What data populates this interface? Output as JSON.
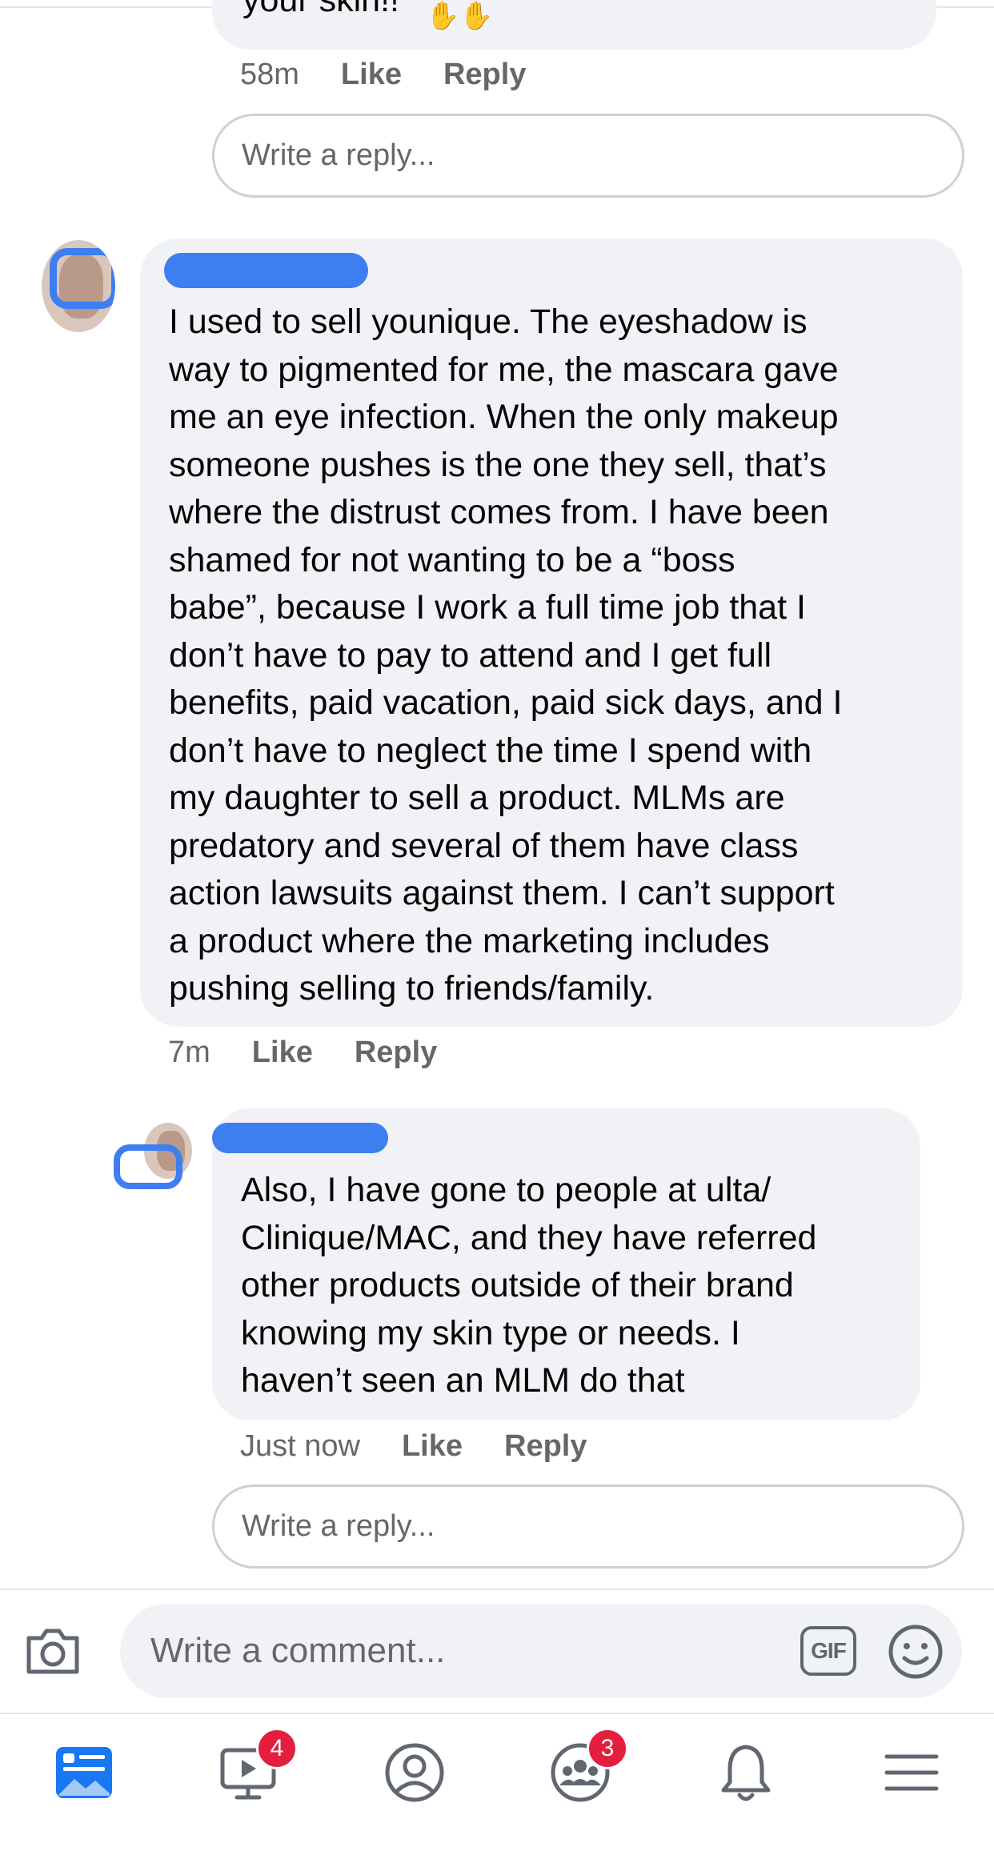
{
  "thread": {
    "prev_reply": {
      "text_fragment": "your skin!!",
      "time": "58m",
      "like": "Like",
      "reply": "Reply"
    },
    "reply_box_1": {
      "placeholder": "Write a reply..."
    },
    "comment": {
      "author": "",
      "text": "I used to sell younique. The eyeshadow is\nway to pigmented for me, the mascara gave\nme an eye infection. When the only makeup\nsomeone pushes is the one they sell, that’s\nwhere the distrust comes from. I have been\nshamed for not wanting to be a “boss\nbabe”, because I work a full time job that I\ndon’t have to pay to attend and I get full\nbenefits, paid vacation, paid sick days, and I\ndon’t have to neglect the time I spend with\nmy daughter to sell a product. MLMs are\npredatory and several of them have class\naction lawsuits against them. I can’t support\na product where the marketing includes\npushing selling to friends/family.",
      "time": "7m",
      "like": "Like",
      "reply": "Reply"
    },
    "reply": {
      "author": "",
      "text": "Also, I have gone to people at ulta/\nClinique/MAC, and they have referred\nother products outside of their brand\nknowing my skin type or needs. I\nhaven’t seen an MLM do that",
      "time": "Just now",
      "like": "Like",
      "reply": "Reply"
    },
    "reply_box_2": {
      "placeholder": "Write a reply..."
    }
  },
  "composer": {
    "placeholder": "Write a comment...",
    "gif_label": "GIF",
    "icons": [
      "camera-icon",
      "gif-icon",
      "emoji-icon"
    ]
  },
  "tabbar": {
    "tabs": [
      {
        "icon": "news-feed-icon",
        "badge": "",
        "active": true
      },
      {
        "icon": "watch-icon",
        "badge": "4",
        "active": false
      },
      {
        "icon": "profile-icon",
        "badge": "",
        "active": false
      },
      {
        "icon": "groups-icon",
        "badge": "3",
        "active": false
      },
      {
        "icon": "bell-icon",
        "badge": "",
        "active": false
      },
      {
        "icon": "menu-icon",
        "badge": "",
        "active": false
      }
    ]
  },
  "colors": {
    "accent": "#1877f2",
    "bubble": "#f0f2f5",
    "meta_text": "#65676b",
    "badge": "#e41e3f",
    "redaction": "#3d7ef0"
  }
}
